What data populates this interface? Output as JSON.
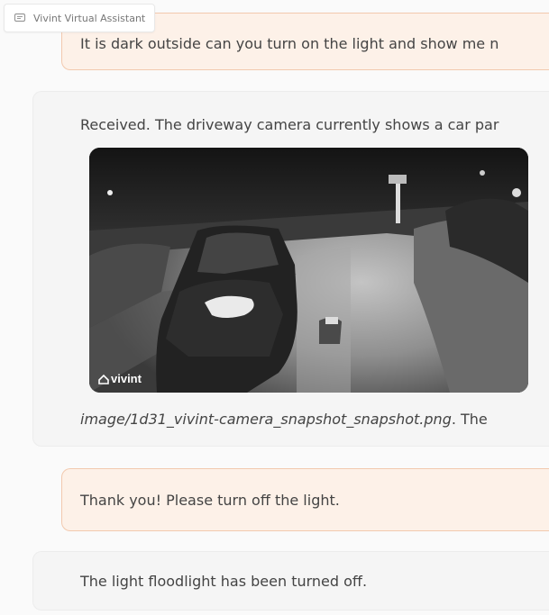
{
  "app": {
    "title": "Vivint Virtual Assistant",
    "icon": "chat-icon"
  },
  "messages": [
    {
      "role": "user",
      "text": "It is dark outside can you turn on the light and show me n"
    },
    {
      "role": "assistant",
      "text": "Received. The driveway camera currently shows a car par",
      "image_watermark": "vivint",
      "image_path": "image/1d31_vivint-camera_snapshot_snapshot.png",
      "after_path": ". The"
    },
    {
      "role": "user",
      "text": "Thank you! Please turn off the light."
    },
    {
      "role": "assistant",
      "text": "The light floodlight has been turned off."
    }
  ],
  "colors": {
    "user_bubble": "#fdf1e8",
    "user_border": "#f2c9ae",
    "assistant_bubble": "#f5f5f5",
    "text": "#444444"
  }
}
